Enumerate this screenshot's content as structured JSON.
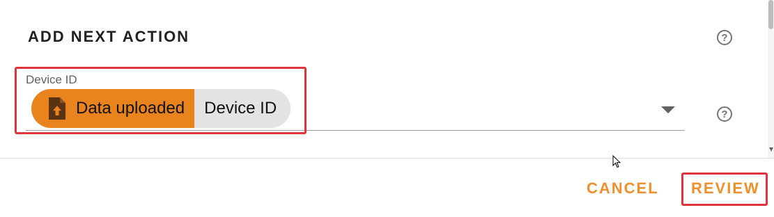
{
  "dialog": {
    "title": "ADD NEXT ACTION",
    "help_icon": "help-circle-icon"
  },
  "field": {
    "label": "Device ID",
    "chip": {
      "icon": "file-upload-icon",
      "event_label": "Data uploaded",
      "attribute_label": "Device ID"
    },
    "dropdown_icon": "caret-down-icon",
    "help_icon": "help-circle-icon"
  },
  "actions": {
    "cancel_label": "CANCEL",
    "review_label": "REVIEW"
  },
  "colors": {
    "accent": "#f0902a",
    "chip_event_bg": "#e8831e",
    "chip_attr_bg": "#e3e3e3",
    "highlight": "#e0353b"
  }
}
